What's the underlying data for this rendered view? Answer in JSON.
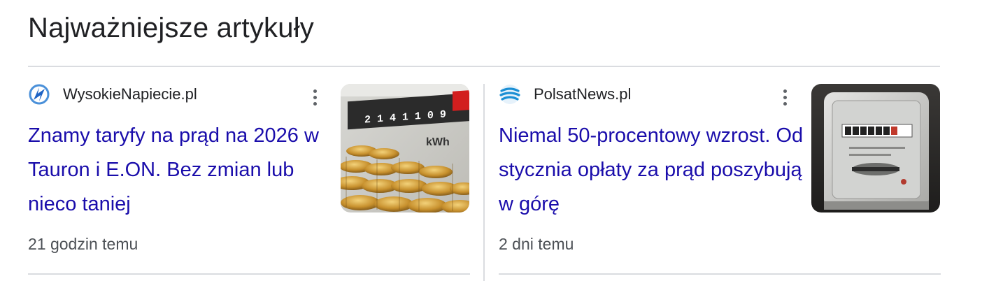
{
  "section": {
    "title": "Najważniejsze artykuły"
  },
  "articles": [
    {
      "source": "WysokieNapiecie.pl",
      "headline": "Znamy taryfy na prąd na 2026 w Tauron i E.ON. Bez zmian lub nieco taniej",
      "time": "21 godzin temu",
      "icon": "wysokienapiecie-logo-icon",
      "thumbnail": "electricity-meter-coins-image",
      "meter_digits": "2 1 4 1 1 0 9",
      "meter_unit": "kWh"
    },
    {
      "source": "PolsatNews.pl",
      "headline": "Niemal 50-procentowy wzrost. Od stycznia opłaty za prąd poszybują w górę",
      "time": "2 dni temu",
      "icon": "polsatnews-logo-icon",
      "thumbnail": "electricity-meter-image"
    }
  ],
  "colors": {
    "link": "#1a0dab",
    "text": "#202124",
    "meta": "#4d5156",
    "divider": "#dadce0"
  }
}
